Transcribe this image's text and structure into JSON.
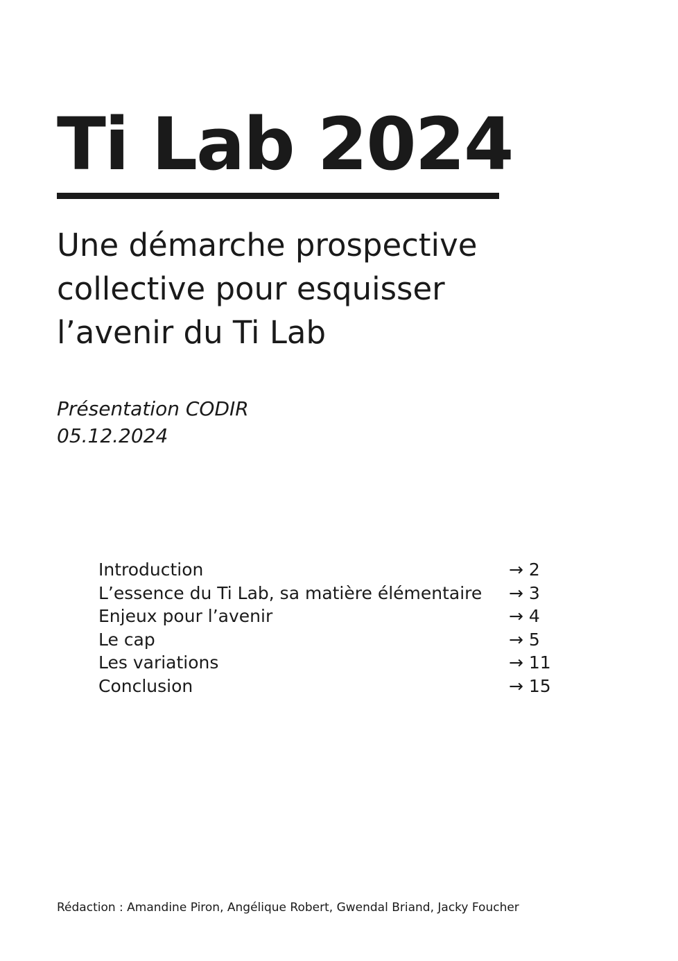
{
  "document": {
    "title": "Ti Lab 2024",
    "subtitle_lines": [
      "Une démarche prospective",
      "collective pour esquisser",
      "l’avenir du Ti Lab"
    ],
    "presentation": "Présentation CODIR",
    "date": "05.12.2024"
  },
  "toc": {
    "items": [
      {
        "label": "Introduction",
        "page": "→ 2"
      },
      {
        "label": "L’essence du Ti Lab, sa matière élémentaire",
        "page": "→ 3"
      },
      {
        "label": "Enjeux pour l’avenir",
        "page": "→ 4"
      },
      {
        "label": "Le cap",
        "page": "→ 5"
      },
      {
        "label": "Les variations",
        "page": "→ 11"
      },
      {
        "label": "Conclusion",
        "page": "→ 15"
      }
    ]
  },
  "credits": {
    "text": "Rédaction : Amandine Piron, Angélique Robert, Gwendal Briand, Jacky Foucher"
  }
}
